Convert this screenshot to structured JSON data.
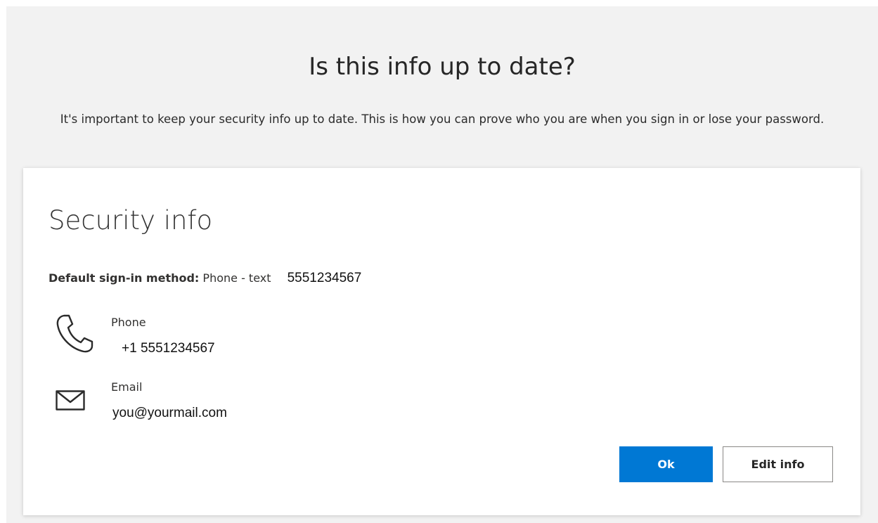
{
  "header": {
    "title": "Is this info up to date?",
    "subtitle": "It's important to keep your security info up to date. This is how you can prove who you are when you sign in or lose your password."
  },
  "card": {
    "title": "Security info",
    "default_label": "Default sign-in method:",
    "default_method": "Phone - text",
    "default_number": "5551234567",
    "methods": [
      {
        "icon": "phone-icon",
        "label": "Phone",
        "value": "+1 5551234567"
      },
      {
        "icon": "email-icon",
        "label": "Email",
        "value": "you@yourmail.com"
      }
    ]
  },
  "buttons": {
    "ok_label": "Ok",
    "edit_label": "Edit info"
  },
  "colors": {
    "accent": "#0078d4",
    "page_background": "#f2f2f2",
    "card_background": "#ffffff"
  }
}
